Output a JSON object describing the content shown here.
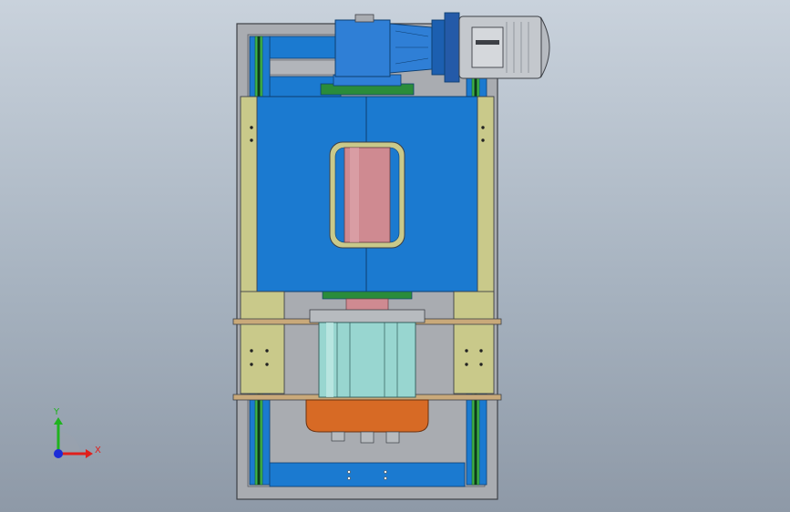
{
  "triad": {
    "x_label": "X",
    "y_label": "Y",
    "x_color": "#e0201c",
    "y_color": "#1fb31f",
    "z_color": "#1c2cd8"
  },
  "colors": {
    "frame": "#a9acb1",
    "frame_outline": "#3d4046",
    "panel_blue": "#1b7ad0",
    "panel_blue_dark": "#1460a6",
    "rail_green": "#3fb34a",
    "yellow_plate": "#c9c98a",
    "roller_pink": "#cf8a91",
    "cylinder_cyan": "#98d6d0",
    "tank_orange": "#d76a25",
    "motor_silver": "#c4c8cd",
    "gearbox_blue": "#2f7fd6"
  }
}
